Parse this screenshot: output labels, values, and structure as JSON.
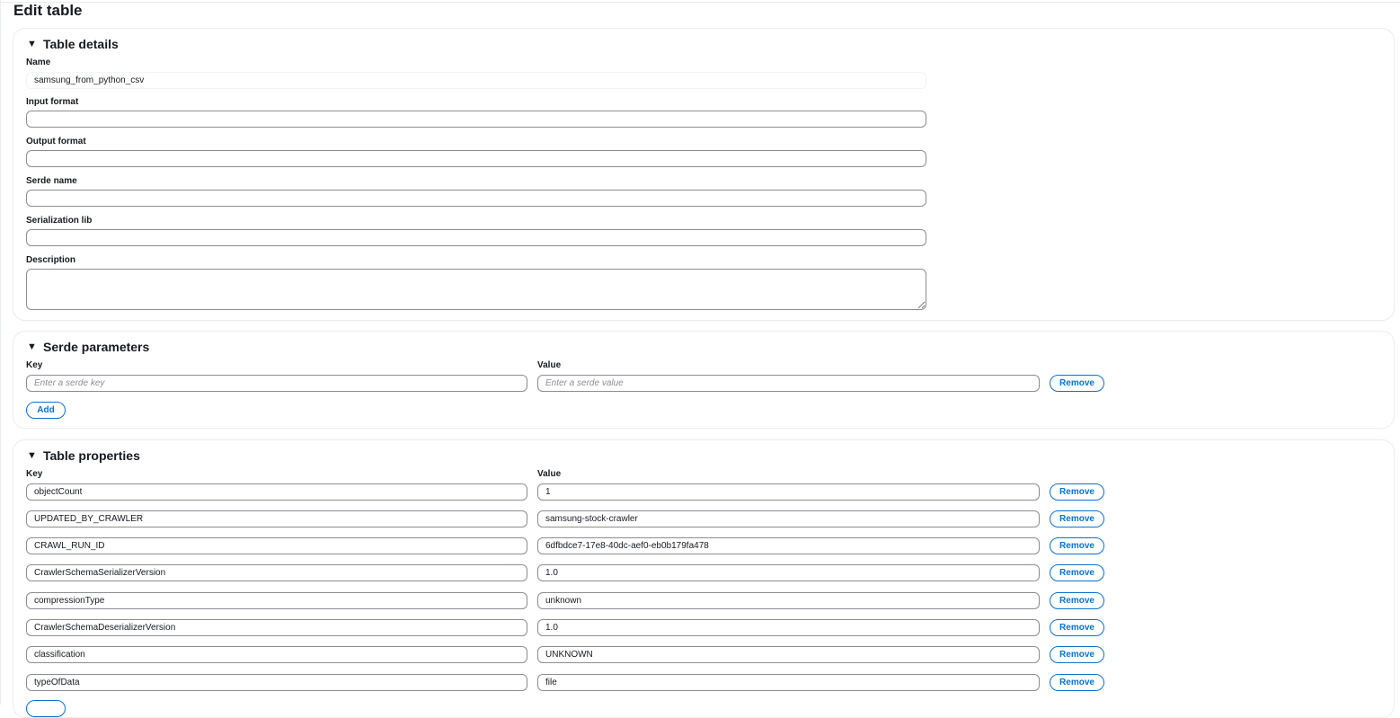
{
  "page": {
    "title": "Edit table"
  },
  "table_details": {
    "title": "Table details",
    "name": {
      "label": "Name",
      "value": "samsung_from_python_csv"
    },
    "input_format": {
      "label": "Input format",
      "value": ""
    },
    "output_format": {
      "label": "Output format",
      "value": ""
    },
    "serde_name": {
      "label": "Serde name",
      "value": ""
    },
    "serialization_lib": {
      "label": "Serialization lib",
      "value": ""
    },
    "description": {
      "label": "Description",
      "value": ""
    }
  },
  "serde_parameters": {
    "title": "Serde parameters",
    "key_header": "Key",
    "value_header": "Value",
    "key_placeholder": "Enter a serde key",
    "value_placeholder": "Enter a serde value",
    "remove_label": "Remove",
    "add_label": "Add"
  },
  "table_properties": {
    "title": "Table properties",
    "key_header": "Key",
    "value_header": "Value",
    "remove_label": "Remove",
    "rows": [
      {
        "key": "objectCount",
        "value": "1"
      },
      {
        "key": "UPDATED_BY_CRAWLER",
        "value": "samsung-stock-crawler"
      },
      {
        "key": "CRAWL_RUN_ID",
        "value": "6dfbdce7-17e8-40dc-aef0-eb0b179fa478"
      },
      {
        "key": "CrawlerSchemaSerializerVersion",
        "value": "1.0"
      },
      {
        "key": "compressionType",
        "value": "unknown"
      },
      {
        "key": "CrawlerSchemaDeserializerVersion",
        "value": "1.0"
      },
      {
        "key": "classification",
        "value": "UNKNOWN"
      },
      {
        "key": "typeOfData",
        "value": "file"
      }
    ]
  },
  "colors": {
    "accent": "#0972d3",
    "border": "#8c8c94",
    "panel_border": "#e9ebed"
  }
}
